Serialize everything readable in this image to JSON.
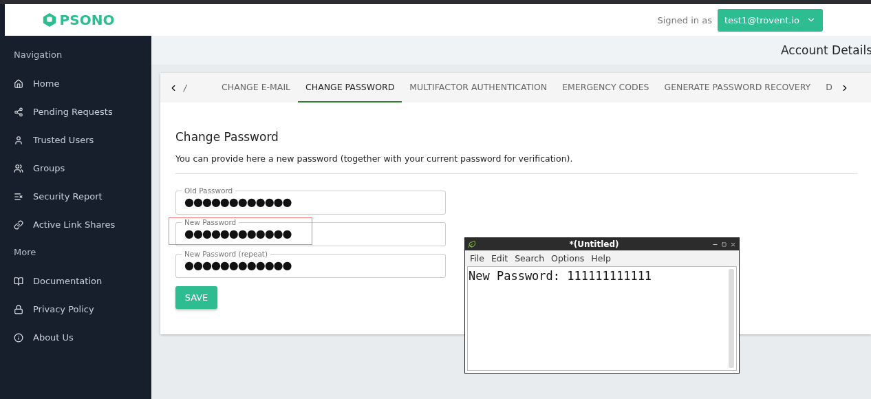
{
  "header": {
    "logo": "PSONO",
    "signed_in_label": "Signed in as",
    "user_menu": "test1@trovent.io"
  },
  "sidebar": {
    "sections": [
      {
        "title": "Navigation",
        "items": [
          {
            "label": "Home",
            "kind": "home"
          },
          {
            "label": "Pending Requests",
            "kind": "share"
          },
          {
            "label": "Trusted Users",
            "kind": "user"
          },
          {
            "label": "Groups",
            "kind": "users"
          },
          {
            "label": "Security Report",
            "kind": "report"
          },
          {
            "label": "Active Link Shares",
            "kind": "link"
          }
        ]
      },
      {
        "title": "More",
        "items": [
          {
            "label": "Documentation",
            "kind": "book"
          },
          {
            "label": "Privacy Policy",
            "kind": "lock"
          },
          {
            "label": "About Us",
            "kind": "info"
          }
        ]
      }
    ]
  },
  "page_title": "Account Details",
  "tabs": {
    "prefix": "/",
    "items": [
      {
        "label": "CHANGE E-MAIL",
        "selected": false
      },
      {
        "label": "CHANGE PASSWORD",
        "selected": true
      },
      {
        "label": "MULTIFACTOR AUTHENTICATION",
        "selected": false
      },
      {
        "label": "EMERGENCY CODES",
        "selected": false
      },
      {
        "label": "GENERATE PASSWORD RECOVERY",
        "selected": false
      },
      {
        "label": "D",
        "selected": false
      }
    ]
  },
  "form": {
    "title": "Change Password",
    "description": "You can provide here a new password (together with your current password for verification).",
    "fields": [
      {
        "label": "Old Password",
        "value": "●●●●●●●●●●●●",
        "highlighted": false
      },
      {
        "label": "New Password",
        "value": "●●●●●●●●●●●●",
        "highlighted": true
      },
      {
        "label": "New Password (repeat)",
        "value": "●●●●●●●●●●●●",
        "highlighted": false
      }
    ],
    "button": "SAVE"
  },
  "editor": {
    "title": "*(Untitled)",
    "menu": [
      "File",
      "Edit",
      "Search",
      "Options",
      "Help"
    ],
    "content": "New Password: 111111111111"
  }
}
